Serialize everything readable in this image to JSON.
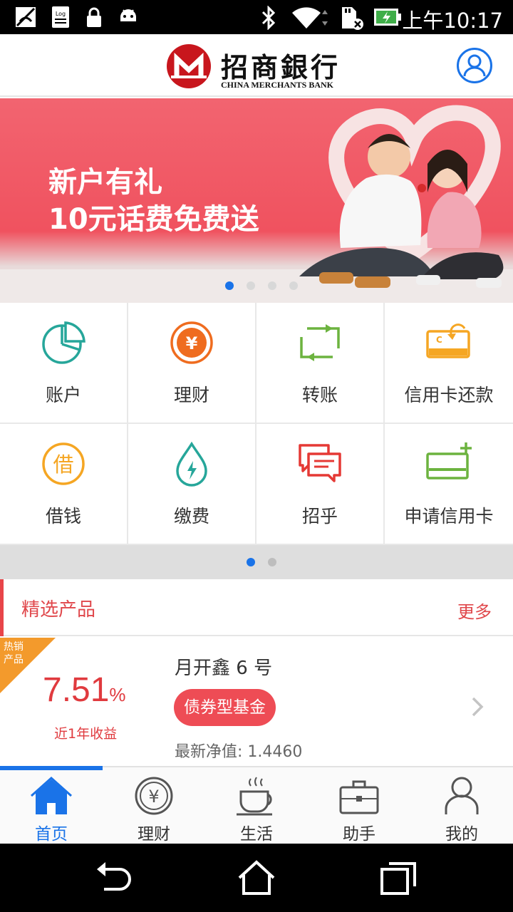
{
  "status_bar": {
    "time": "上午10:17",
    "icons": [
      "no-sim-icon",
      "log-icon",
      "lock-icon",
      "android-icon",
      "bluetooth-icon",
      "wifi-icon",
      "sd-card-icon",
      "battery-charging-icon"
    ],
    "log_text": "Log"
  },
  "header": {
    "bank_name_cn": "招商銀行",
    "bank_name_en": "CHINA MERCHANTS BANK",
    "logo_color": "#c8161d",
    "user_icon": "user-circle-icon",
    "accent": "#1a73e8"
  },
  "banner": {
    "line1": "新户有礼",
    "line2": "10元话费免费送",
    "background": "#f0525f",
    "page_count": 4,
    "active_page": 1
  },
  "grid": {
    "items": [
      {
        "label": "账户",
        "icon": "pie-chart-icon",
        "color": "#26a69a"
      },
      {
        "label": "理财",
        "icon": "yuan-coin-icon",
        "color": "#ef6c1f"
      },
      {
        "label": "转账",
        "icon": "transfer-icon",
        "color": "#6cb33f"
      },
      {
        "label": "信用卡还款",
        "icon": "card-repay-icon",
        "color": "#f5a623"
      },
      {
        "label": "借钱",
        "icon": "borrow-icon",
        "color": "#f5a623"
      },
      {
        "label": "缴费",
        "icon": "water-drop-icon",
        "color": "#26a69a"
      },
      {
        "label": "招乎",
        "icon": "chat-bubbles-icon",
        "color": "#e53935"
      },
      {
        "label": "申请信用卡",
        "icon": "card-add-icon",
        "color": "#6cb33f"
      }
    ],
    "borrow_glyph": "借",
    "yuan_glyph": "¥",
    "page_count": 2,
    "active_page": 1
  },
  "products": {
    "title": "精选产品",
    "more": "更多",
    "accent": "#e0474b",
    "item": {
      "badge": "热销产品",
      "rate_value": "7.51",
      "rate_unit": "%",
      "rate_label": "近1年收益",
      "name": "月开鑫 6 号",
      "tag": "债券型基金",
      "nav_label": "最新净值:",
      "nav_value": "1.4460"
    }
  },
  "tabbar": {
    "tabs": [
      {
        "label": "首页",
        "icon": "home-icon",
        "active": true
      },
      {
        "label": "理财",
        "icon": "yuan-coin-icon",
        "active": false
      },
      {
        "label": "生活",
        "icon": "coffee-cup-icon",
        "active": false
      },
      {
        "label": "助手",
        "icon": "briefcase-icon",
        "active": false
      },
      {
        "label": "我的",
        "icon": "person-icon",
        "active": false
      }
    ]
  },
  "system_nav": {
    "buttons": [
      "back-icon",
      "home-outline-icon",
      "recent-apps-icon"
    ]
  }
}
